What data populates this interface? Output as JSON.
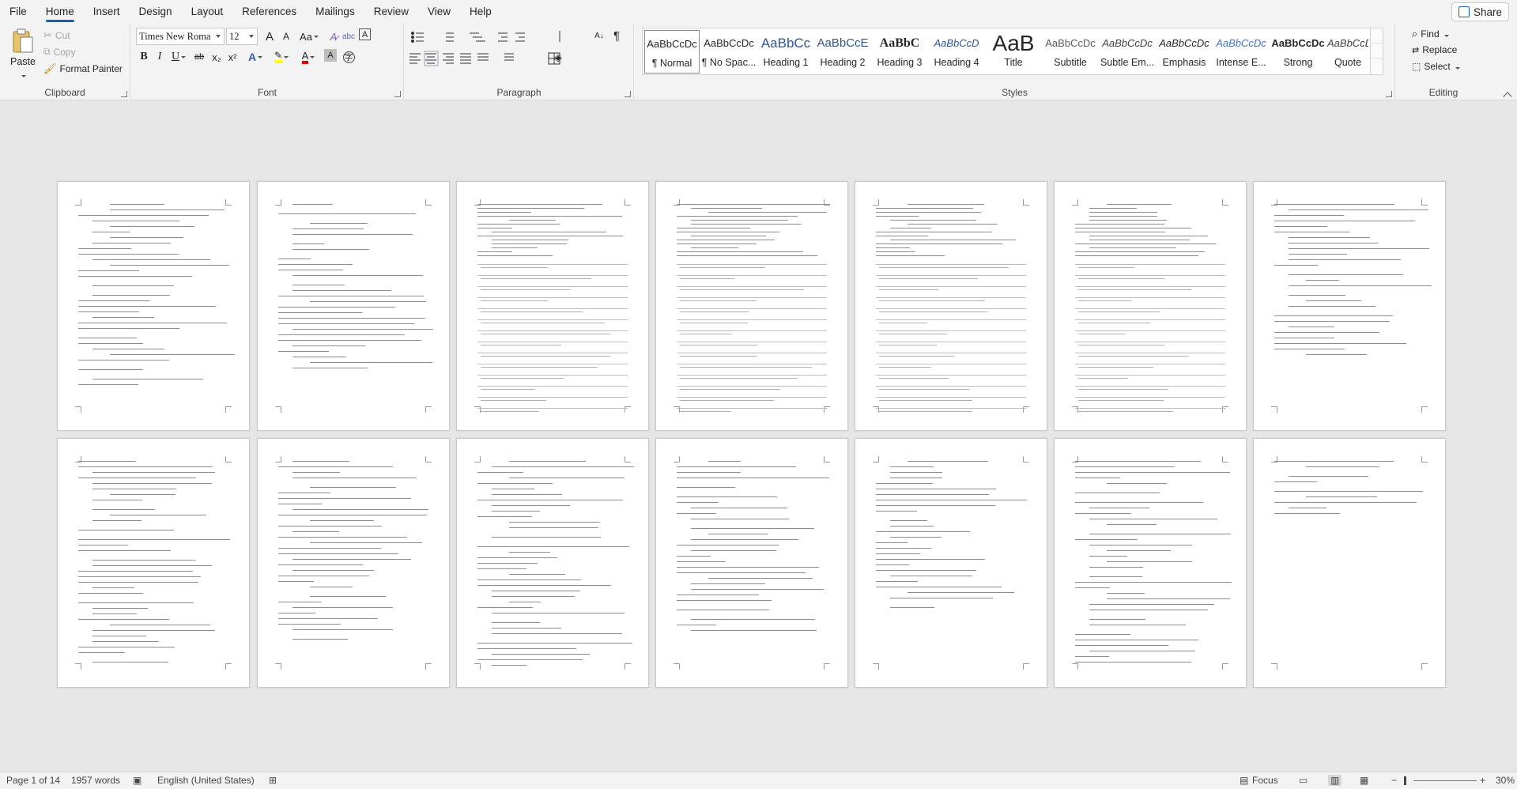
{
  "menu": {
    "tabs": [
      "File",
      "Home",
      "Insert",
      "Design",
      "Layout",
      "References",
      "Mailings",
      "Review",
      "View",
      "Help"
    ],
    "active": "Home",
    "share_label": "Share"
  },
  "clipboard": {
    "paste": "Paste",
    "cut": "Cut",
    "copy": "Copy",
    "format_painter": "Format Painter",
    "label": "Clipboard"
  },
  "font": {
    "name": "Times New Roma",
    "size": "12",
    "label": "Font",
    "bold": "B",
    "italic": "I",
    "underline": "U",
    "strike": "ab",
    "subscript": "x₂",
    "superscript": "x²",
    "change_case": "Aa",
    "grow": "A",
    "shrink": "A"
  },
  "paragraph": {
    "label": "Paragraph",
    "pilcrow": "¶"
  },
  "styles": {
    "label": "Styles",
    "items": [
      {
        "preview": "AaBbCcDc",
        "name": "¶ Normal"
      },
      {
        "preview": "AaBbCcDc",
        "name": "¶ No Spac..."
      },
      {
        "preview": "AaBbCc",
        "name": "Heading 1"
      },
      {
        "preview": "AaBbCcE",
        "name": "Heading 2"
      },
      {
        "preview": "AaBbC",
        "name": "Heading 3"
      },
      {
        "preview": "AaBbCcD",
        "name": "Heading 4"
      },
      {
        "preview": "AaB",
        "name": "Title"
      },
      {
        "preview": "AaBbCcDc",
        "name": "Subtitle"
      },
      {
        "preview": "AaBbCcDc",
        "name": "Subtle Em..."
      },
      {
        "preview": "AaBbCcDc",
        "name": "Emphasis"
      },
      {
        "preview": "AaBbCcDc",
        "name": "Intense E..."
      },
      {
        "preview": "AaBbCcDc",
        "name": "Strong"
      },
      {
        "preview": "AaBbCcDc",
        "name": "Quote"
      }
    ]
  },
  "editing": {
    "label": "Editing",
    "find": "Find",
    "replace": "Replace",
    "select": "Select"
  },
  "status": {
    "page": "Page 1 of 14",
    "words": "1957 words",
    "language": "English (United States)",
    "focus": "Focus",
    "zoom": "30%",
    "zoom_minus": "−",
    "zoom_plus": "+"
  },
  "colors": {
    "accent": "#185abd",
    "heading_blue": "#2f5496",
    "ribbon_bg": "#f3f3f3",
    "canvas_bg": "#e6e6e6"
  }
}
